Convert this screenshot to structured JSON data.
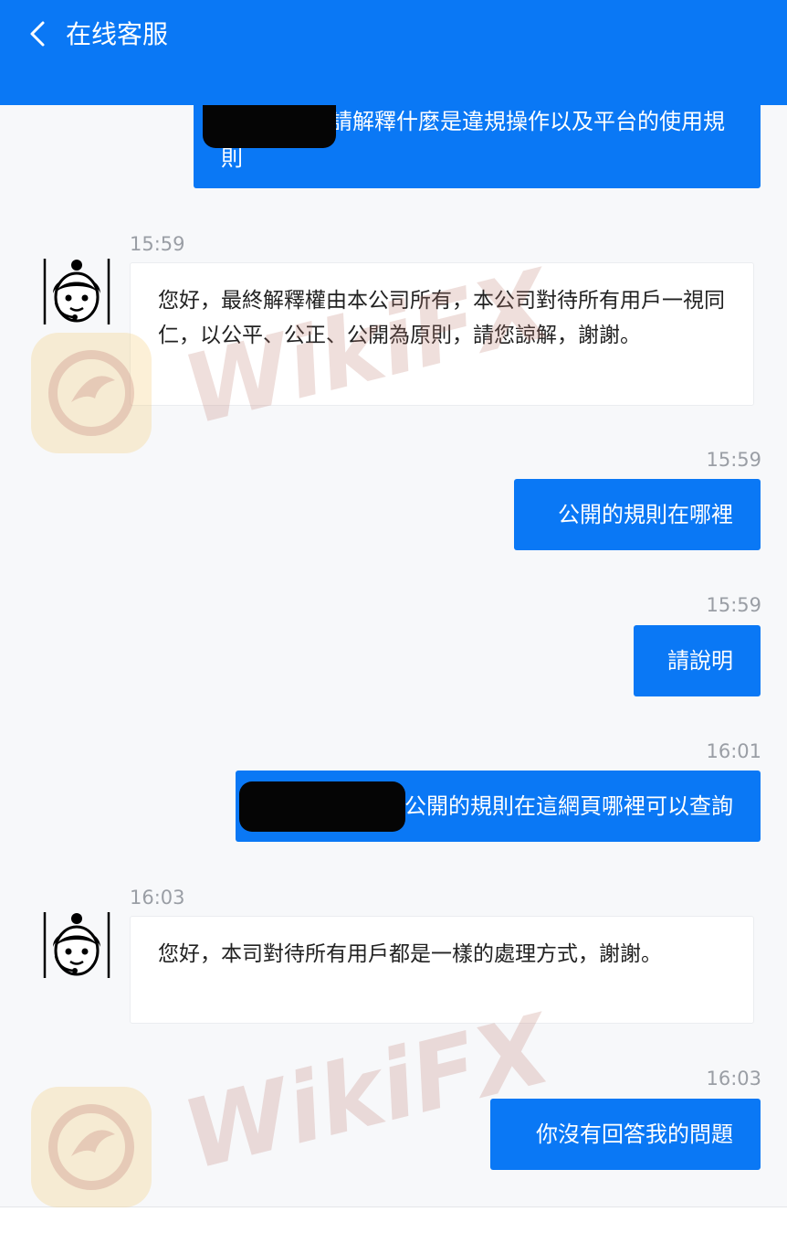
{
  "header": {
    "title": "在线客服"
  },
  "messages": {
    "m1": {
      "text": "請解釋什麼是違規操作以及平台的使用規則"
    },
    "m2": {
      "time": "15:59",
      "text": "您好，最終解釋權由本公司所有，本公司對待所有用戶一視同仁，以公平、公正、公開為原則，請您諒解，謝謝。"
    },
    "m3": {
      "time": "15:59",
      "text": "公開的規則在哪裡"
    },
    "m4": {
      "time": "15:59",
      "text": "請說明"
    },
    "m5": {
      "time": "16:01",
      "text": "公開的規則在這網頁哪裡可以查詢"
    },
    "m6": {
      "time": "16:03",
      "text": "您好，本司對待所有用戶都是一樣的處理方式，謝謝。"
    },
    "m7": {
      "time": "16:03",
      "text": "你沒有回答我的問題"
    }
  },
  "watermark": {
    "text": "WikiFX"
  },
  "colors": {
    "accent": "#0a78f5",
    "background": "#f7f8fa"
  }
}
